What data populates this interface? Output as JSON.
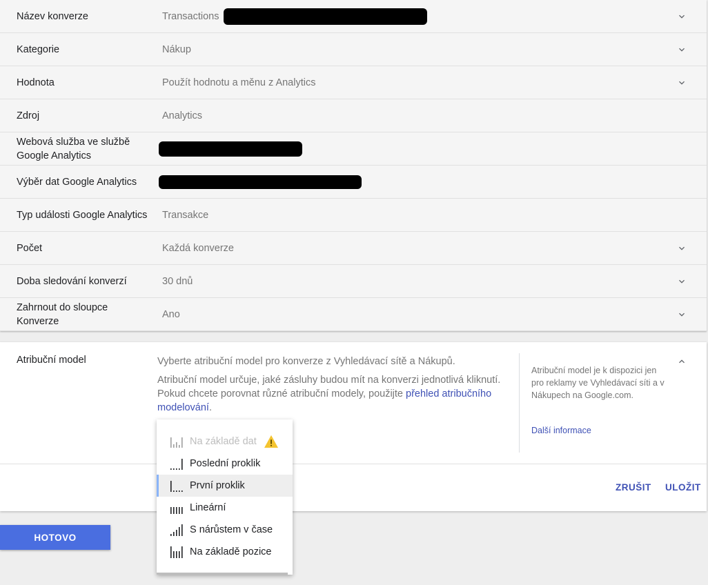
{
  "settings": {
    "rows": [
      {
        "label": "Název konverze",
        "value": "Transactions",
        "redacted": true,
        "chevron": true
      },
      {
        "label": "Kategorie",
        "value": "Nákup",
        "redacted": false,
        "chevron": true
      },
      {
        "label": "Hodnota",
        "value": "Použít hodnotu a měnu z Analytics",
        "redacted": false,
        "chevron": true
      },
      {
        "label": "Zdroj",
        "value": "Analytics",
        "redacted": false,
        "chevron": false
      },
      {
        "label": "Webová služba ve službě Google Analytics",
        "value": "",
        "redacted": true,
        "chevron": false
      },
      {
        "label": "Výběr dat Google Analytics",
        "value": "",
        "redacted": true,
        "chevron": false
      },
      {
        "label": "Typ události Google Analytics",
        "value": "Transakce",
        "redacted": false,
        "chevron": false
      },
      {
        "label": "Počet",
        "value": "Každá konverze",
        "redacted": false,
        "chevron": true
      },
      {
        "label": "Doba sledování konverzí",
        "value": "30 dnů",
        "redacted": false,
        "chevron": true
      },
      {
        "label": "Zahrnout do sloupce Konverze",
        "value": "Ano",
        "redacted": false,
        "chevron": true
      }
    ]
  },
  "attribution": {
    "label": "Atribuční model",
    "intro": "Vyberte atribuční model pro konverze z Vyhledávací sítě a Nákupů.",
    "desc_prefix": "Atribuční model určuje, jaké zásluhy budou mít na konverzi jednotlivá kliknutí. Pokud chcete porovnat různé atribuční modely, použijte ",
    "desc_link": "přehled atribučního modelování",
    "desc_suffix": ".",
    "side_note": "Atribuční model je k dispozici jen pro reklamy ve Vyhledávací síti a v Nákupech na Google.com.",
    "side_link": "Další informace",
    "cancel_label": "ZRUŠIT",
    "save_label": "ULOŽIT"
  },
  "dropdown": {
    "options": [
      {
        "label": "Na základě dat",
        "icon": "data-driven-icon",
        "disabled": true,
        "warning": true,
        "selected": false
      },
      {
        "label": "Poslední proklik",
        "icon": "last-click-icon",
        "disabled": false,
        "warning": false,
        "selected": false
      },
      {
        "label": "První proklik",
        "icon": "first-click-icon",
        "disabled": false,
        "warning": false,
        "selected": true
      },
      {
        "label": "Lineární",
        "icon": "linear-icon",
        "disabled": false,
        "warning": false,
        "selected": false
      },
      {
        "label": "S nárůstem v čase",
        "icon": "time-decay-icon",
        "disabled": false,
        "warning": false,
        "selected": false
      },
      {
        "label": "Na základě pozice",
        "icon": "position-based-icon",
        "disabled": false,
        "warning": false,
        "selected": false
      }
    ]
  },
  "footer": {
    "done_label": "HOTOVO"
  },
  "colors": {
    "accent": "#3f51b5",
    "primary_button": "#4a6ee0",
    "warning": "#f4c430"
  }
}
